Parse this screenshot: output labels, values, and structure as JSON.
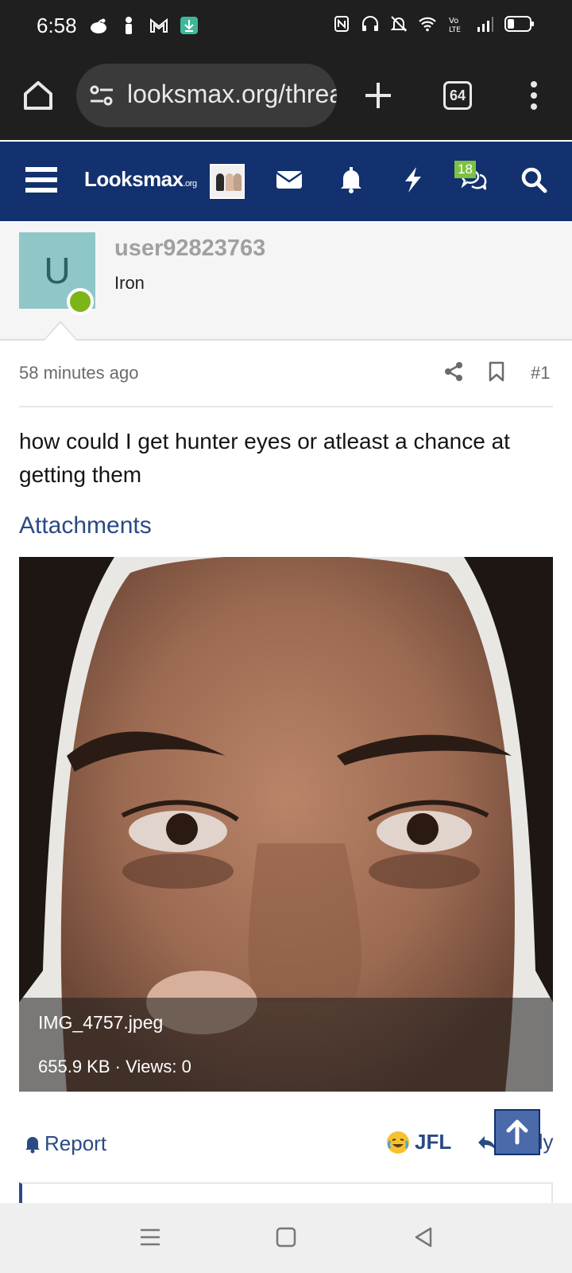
{
  "status_bar": {
    "time": "6:58",
    "icons": [
      "reddit-icon",
      "notification-icon",
      "gmail-icon",
      "download-icon",
      "nfc-icon",
      "headset-icon",
      "silent-icon",
      "wifi-icon",
      "volte-icon",
      "signal-icon",
      "battery-icon"
    ]
  },
  "browser": {
    "url": "looksmax.org/threads",
    "tab_count": "64"
  },
  "site_header": {
    "logo_text": "Looksmax",
    "logo_suffix": ".org",
    "notification_badge": "18",
    "accent": "#12316e"
  },
  "post": {
    "username": "user92823763",
    "user_title": "Iron",
    "avatar_letter": "U",
    "time": "58 minutes ago",
    "number": "#1",
    "body": "how could I get hunter eyes or atleast a chance at getting them",
    "attachments_title": "Attachments",
    "attachment": {
      "filename": "IMG_4757.jpeg",
      "info": "655.9 KB · Views: 0"
    },
    "actions": {
      "report": "Report",
      "reaction": "JFL",
      "reply": "Reply"
    }
  }
}
